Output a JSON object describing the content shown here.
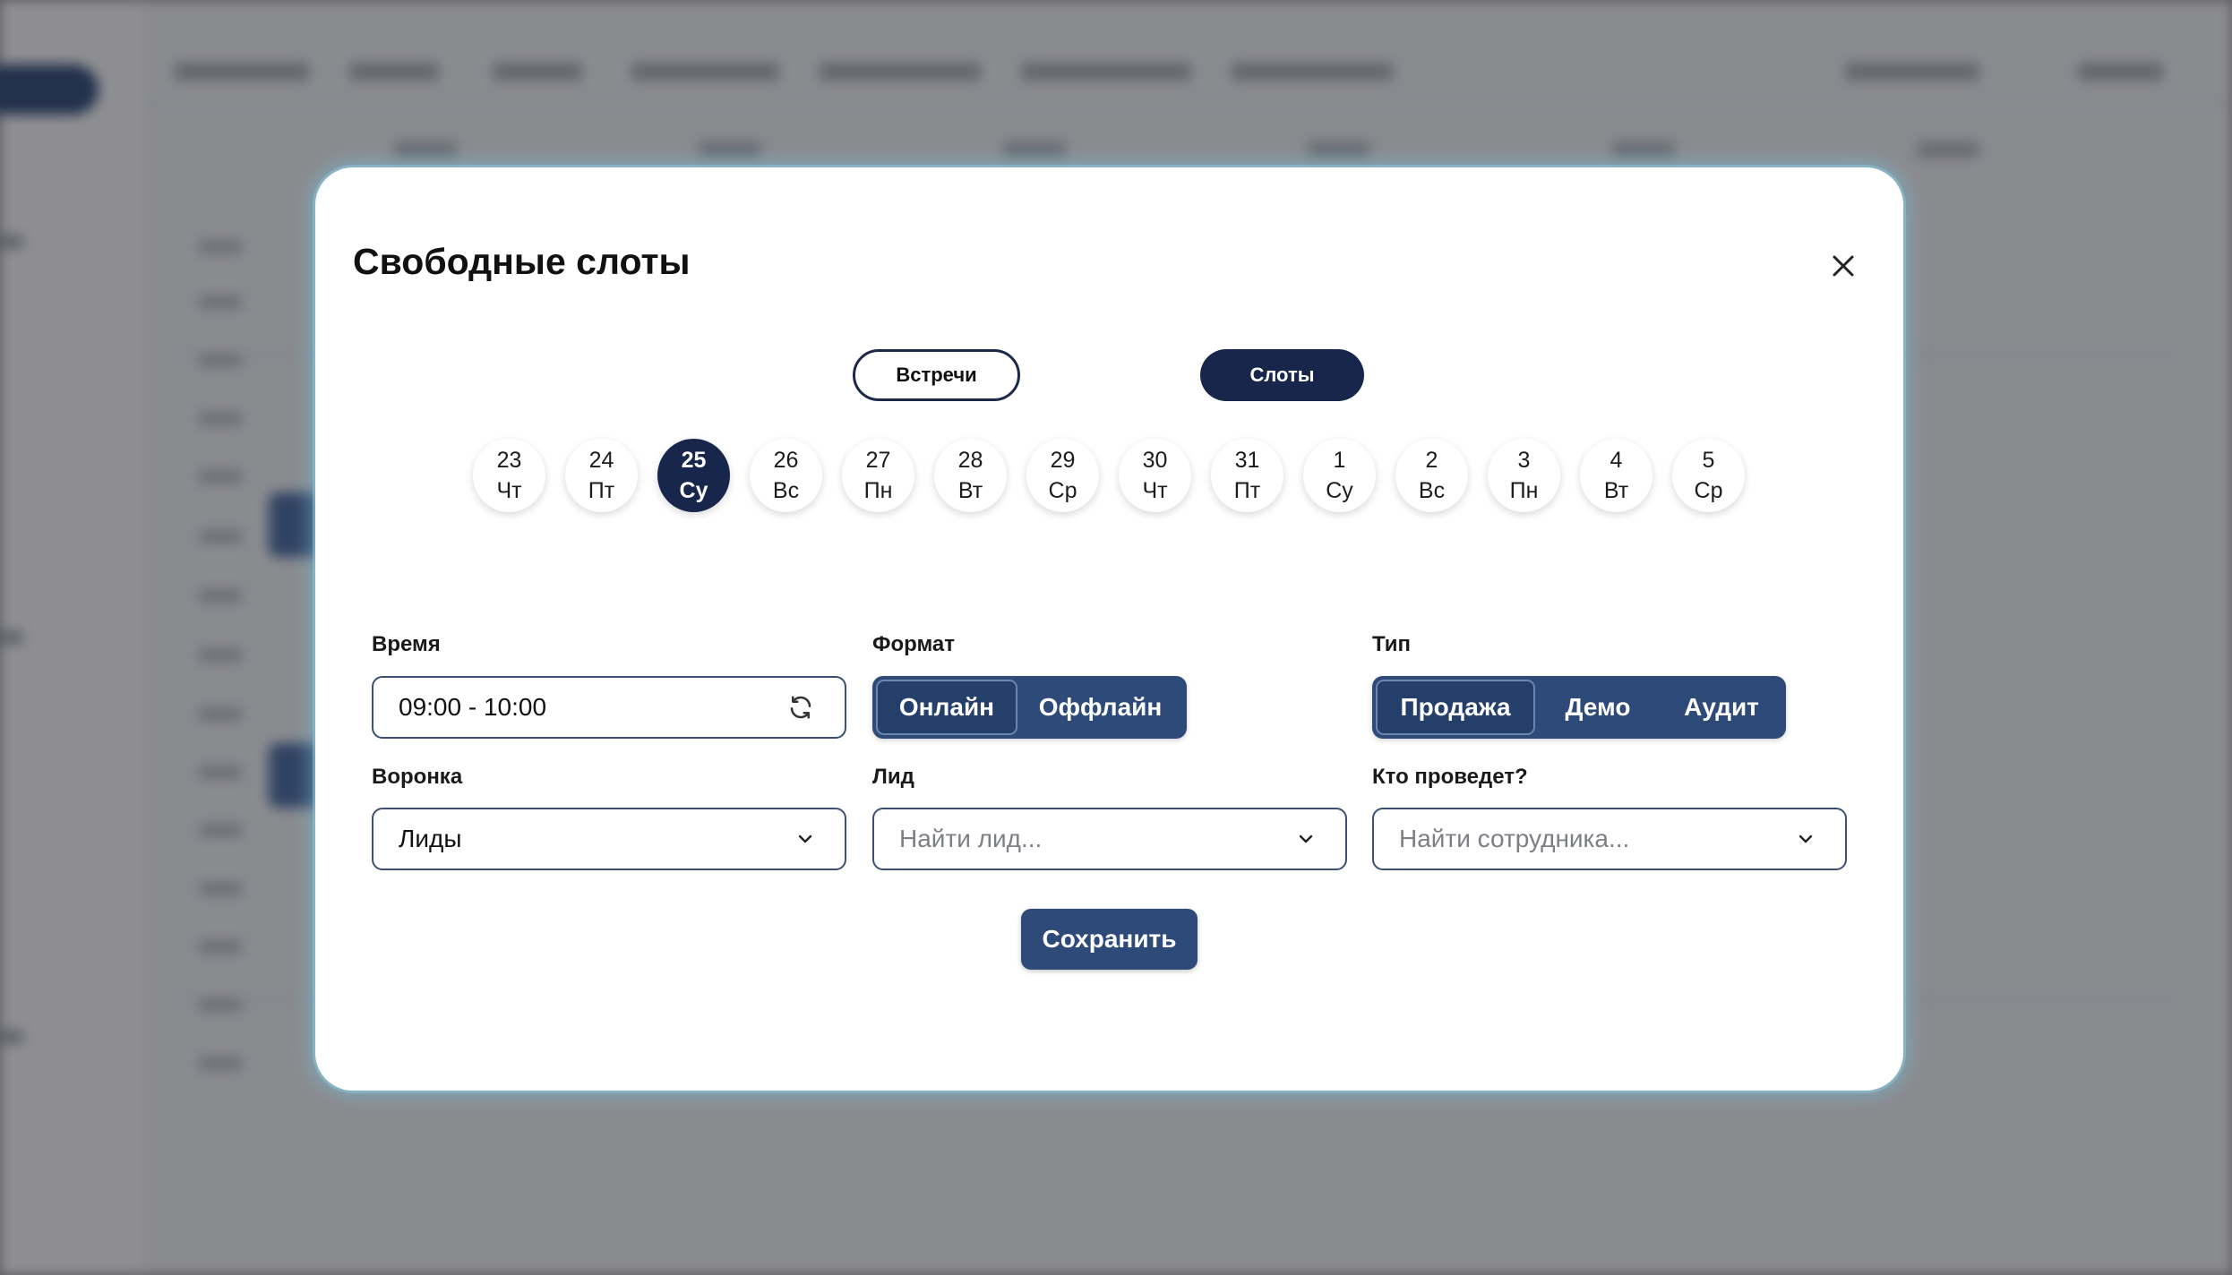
{
  "modal": {
    "title": "Свободные слоты",
    "close_icon": "close-icon",
    "view_toggle": {
      "meetings": "Встречи",
      "slots": "Слоты",
      "active": "slots"
    },
    "days": [
      {
        "num": "23",
        "wd": "Чт"
      },
      {
        "num": "24",
        "wd": "Пт"
      },
      {
        "num": "25",
        "wd": "Су"
      },
      {
        "num": "26",
        "wd": "Вс"
      },
      {
        "num": "27",
        "wd": "Пн"
      },
      {
        "num": "28",
        "wd": "Вт"
      },
      {
        "num": "29",
        "wd": "Ср"
      },
      {
        "num": "30",
        "wd": "Чт"
      },
      {
        "num": "31",
        "wd": "Пт"
      },
      {
        "num": "1",
        "wd": "Су"
      },
      {
        "num": "2",
        "wd": "Вс"
      },
      {
        "num": "3",
        "wd": "Пн"
      },
      {
        "num": "4",
        "wd": "Вт"
      },
      {
        "num": "5",
        "wd": "Ср"
      }
    ],
    "selected_day": "25",
    "time": {
      "label": "Время",
      "value": "09:00 - 10:00",
      "icon": "refresh-icon"
    },
    "format": {
      "label": "Формат",
      "options": [
        "Онлайн",
        "Оффлайн"
      ],
      "selected": "Онлайн"
    },
    "type": {
      "label": "Тип",
      "options": [
        "Продажа",
        "Демо",
        "Аудит"
      ],
      "selected": "Продажа"
    },
    "funnel": {
      "label": "Воронка",
      "value": "Лиды",
      "icon": "chevron-down-icon"
    },
    "lead": {
      "label": "Лид",
      "placeholder": "Найти лид...",
      "icon": "chevron-down-icon"
    },
    "host": {
      "label": "Кто проведет?",
      "placeholder": "Найти сотрудника...",
      "icon": "chevron-down-icon"
    },
    "save_label": "Сохранить"
  },
  "colors": {
    "primary_dark": "#17264a",
    "primary": "#2e4a78",
    "overlay": "#8a8a8c"
  }
}
